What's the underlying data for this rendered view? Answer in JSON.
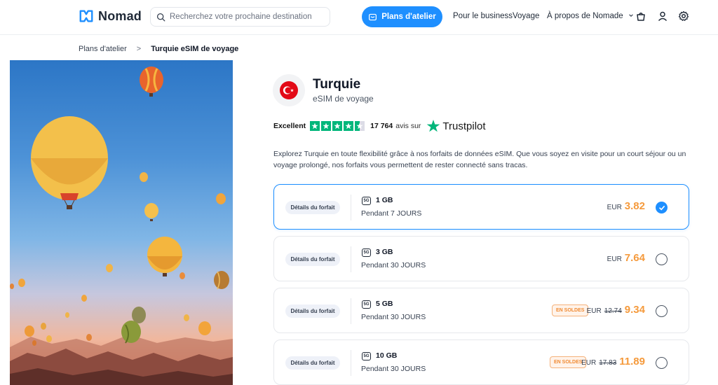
{
  "header": {
    "brand": "Nomad",
    "search_placeholder": "Recherchez votre prochaine destination",
    "cta_label": "Plans d'atelier",
    "nav": [
      "Pour le business",
      "Voyage",
      "À propos de Nomade"
    ],
    "icons": [
      "basket-icon",
      "user-icon",
      "gear-icon"
    ],
    "accent_color": "#1e8fff"
  },
  "breadcrumb": {
    "items": [
      "Plans d'atelier",
      "Turquie eSIM de voyage"
    ],
    "separator": ">"
  },
  "product": {
    "country": "Turquie",
    "subtitle": "eSIM de voyage",
    "flag_icon": "turkey-flag-icon",
    "description": "Explorez Turquie en toute flexibilité grâce à nos forfaits de données eSIM. Que vous soyez en visite pour un court séjour ou un voyage prolongé, nos forfaits vous permettent de rester connecté sans tracas."
  },
  "rating": {
    "label": "Excellent",
    "stars": 4.5,
    "count": "17 764",
    "suffix": "avis sur",
    "provider": "Trustpilot",
    "star_color": "#00b67a"
  },
  "plans": [
    {
      "details_label": "Détails du forfait",
      "network": "5G",
      "data": "1 GB",
      "validity": "Pendant 7 JOURS",
      "currency": "EUR",
      "old_price": "",
      "price": "3.82",
      "sale_label": "",
      "selected": true
    },
    {
      "details_label": "Détails du forfait",
      "network": "5G",
      "data": "3 GB",
      "validity": "Pendant 30 JOURS",
      "currency": "EUR",
      "old_price": "",
      "price": "7.64",
      "sale_label": "",
      "selected": false
    },
    {
      "details_label": "Détails du forfait",
      "network": "5G",
      "data": "5 GB",
      "validity": "Pendant 30 JOURS",
      "currency": "EUR",
      "old_price": "12.74",
      "price": "9.34",
      "sale_label": "EN SOLDES",
      "selected": false
    },
    {
      "details_label": "Détails du forfait",
      "network": "5G",
      "data": "10 GB",
      "validity": "Pendant 30 JOURS",
      "currency": "EUR",
      "old_price": "17.83",
      "price": "11.89",
      "sale_label": "EN SOLDES",
      "selected": false
    }
  ],
  "colors": {
    "price": "#f59a3c",
    "sale_badge": "#f08a32"
  }
}
